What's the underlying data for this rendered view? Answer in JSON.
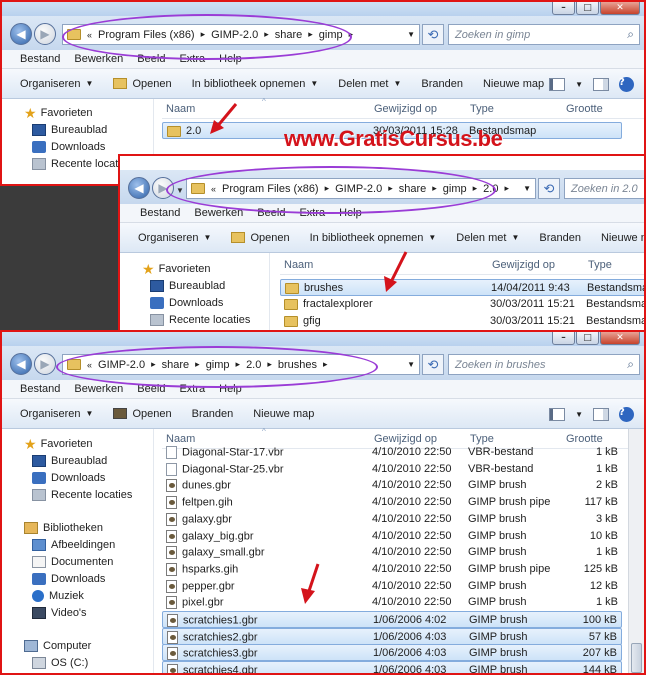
{
  "watermark": "www.GratisCursus.be",
  "window_buttons": {
    "minimize": "–",
    "maximize": "□",
    "close": "✕"
  },
  "menu": {
    "file": "Bestand",
    "edit": "Bewerken",
    "view": "Beeld",
    "extra": "Extra",
    "help": "Help"
  },
  "toolbar": {
    "organize": "Organiseren",
    "open": "Openen",
    "library": "In bibliotheek opnemen",
    "share": "Delen met",
    "burn": "Branden",
    "new_folder": "Nieuwe map"
  },
  "nav": {
    "favorites": "Favorieten",
    "desktop": "Bureaublad",
    "downloads": "Downloads",
    "recent": "Recente locaties",
    "libraries": "Bibliotheken",
    "pictures": "Afbeeldingen",
    "documents": "Documenten",
    "lib_downloads": "Downloads",
    "music": "Muziek",
    "videos": "Video's",
    "computer": "Computer",
    "drive_c": "OS (C:)"
  },
  "columns": {
    "name": "Naam",
    "modified": "Gewijzigd op",
    "type": "Type",
    "size": "Grootte"
  },
  "window1": {
    "crumbs": [
      "Program Files (x86)",
      "GIMP-2.0",
      "share",
      "gimp"
    ],
    "search": "Zoeken in gimp",
    "files": [
      {
        "name": "2.0",
        "date": "30/03/2011 15:28",
        "type": "Bestandsmap",
        "size": ""
      }
    ]
  },
  "window2": {
    "crumbs": [
      "Program Files (x86)",
      "GIMP-2.0",
      "share",
      "gimp",
      "2.0"
    ],
    "search": "Zoeken in 2.0",
    "files": [
      {
        "name": "brushes",
        "date": "14/04/2011 9:43",
        "type": "Bestandsmap"
      },
      {
        "name": "fractalexplorer",
        "date": "30/03/2011 15:21",
        "type": "Bestandsmap"
      },
      {
        "name": "gfig",
        "date": "30/03/2011 15:21",
        "type": "Bestandsmap"
      }
    ]
  },
  "window3": {
    "crumbs": [
      "GIMP-2.0",
      "share",
      "gimp",
      "2.0",
      "brushes"
    ],
    "search": "Zoeken in brushes",
    "files": [
      {
        "name": "Diagonal-Star-17.vbr",
        "date": "4/10/2010 22:50",
        "type": "VBR-bestand",
        "size": "1 kB",
        "kind": "vbr"
      },
      {
        "name": "Diagonal-Star-25.vbr",
        "date": "4/10/2010 22:50",
        "type": "VBR-bestand",
        "size": "1 kB",
        "kind": "vbr"
      },
      {
        "name": "dunes.gbr",
        "date": "4/10/2010 22:50",
        "type": "GIMP brush",
        "size": "2 kB",
        "kind": "gimp"
      },
      {
        "name": "feltpen.gih",
        "date": "4/10/2010 22:50",
        "type": "GIMP brush pipe",
        "size": "117 kB",
        "kind": "gimp"
      },
      {
        "name": "galaxy.gbr",
        "date": "4/10/2010 22:50",
        "type": "GIMP brush",
        "size": "3 kB",
        "kind": "gimp"
      },
      {
        "name": "galaxy_big.gbr",
        "date": "4/10/2010 22:50",
        "type": "GIMP brush",
        "size": "10 kB",
        "kind": "gimp"
      },
      {
        "name": "galaxy_small.gbr",
        "date": "4/10/2010 22:50",
        "type": "GIMP brush",
        "size": "1 kB",
        "kind": "gimp"
      },
      {
        "name": "hsparks.gih",
        "date": "4/10/2010 22:50",
        "type": "GIMP brush pipe",
        "size": "125 kB",
        "kind": "gimp"
      },
      {
        "name": "pepper.gbr",
        "date": "4/10/2010 22:50",
        "type": "GIMP brush",
        "size": "12 kB",
        "kind": "gimp"
      },
      {
        "name": "pixel.gbr",
        "date": "4/10/2010 22:50",
        "type": "GIMP brush",
        "size": "1 kB",
        "kind": "gimp"
      },
      {
        "name": "scratchies1.gbr",
        "date": "1/06/2006 4:02",
        "type": "GIMP brush",
        "size": "100 kB",
        "kind": "gimp",
        "selected": true
      },
      {
        "name": "scratchies2.gbr",
        "date": "1/06/2006 4:03",
        "type": "GIMP brush",
        "size": "57 kB",
        "kind": "gimp",
        "selected": true
      },
      {
        "name": "scratchies3.gbr",
        "date": "1/06/2006 4:03",
        "type": "GIMP brush",
        "size": "207 kB",
        "kind": "gimp",
        "selected": true
      },
      {
        "name": "scratchies4.gbr",
        "date": "1/06/2006 4:03",
        "type": "GIMP brush",
        "size": "144 kB",
        "kind": "gimp",
        "selected": true
      }
    ]
  },
  "colors": {
    "frame": "#e01414",
    "annotation": "#9a3cd6",
    "watermark": "#d4131b"
  }
}
